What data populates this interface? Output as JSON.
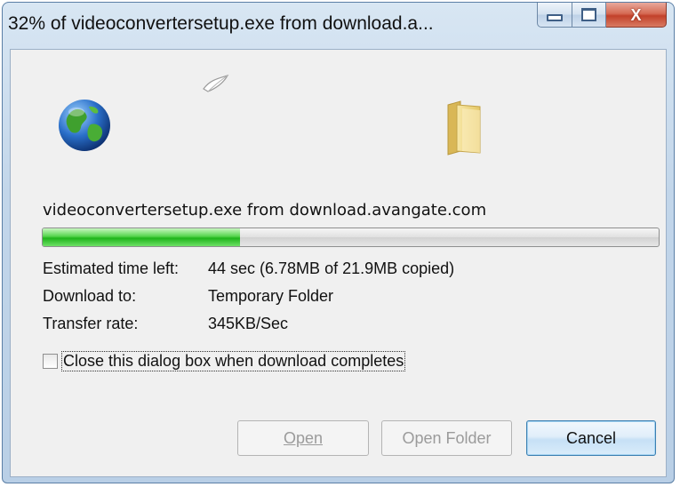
{
  "window": {
    "title": "32% of videoconvertersetup.exe from download.a...",
    "caption_buttons": {
      "minimize_icon": "minimize-icon",
      "maximize_icon": "maximize-icon",
      "close_icon": "close-icon",
      "close_glyph": "X"
    }
  },
  "download": {
    "filename_line": "videoconvertersetup.exe from download.avangate.com",
    "progress_percent": 32,
    "progress_color": "#1fb41b",
    "icons": {
      "source": "globe-icon",
      "transfer": "flying-paper-icon",
      "destination": "folder-icon"
    },
    "estimated_label": "Estimated time left:",
    "estimated_value": "44 sec (6.78MB of 21.9MB copied)",
    "download_to_label": "Download to:",
    "download_to_value": "Temporary Folder",
    "transfer_rate_label": "Transfer rate:",
    "transfer_rate_value": "345KB/Sec",
    "close_when_done": {
      "label": "Close this dialog box when download completes",
      "checked": false
    }
  },
  "buttons": {
    "open": {
      "label": "Open",
      "enabled": false
    },
    "open_folder": {
      "label": "Open Folder",
      "enabled": false
    },
    "cancel": {
      "label": "Cancel",
      "enabled": true
    }
  }
}
